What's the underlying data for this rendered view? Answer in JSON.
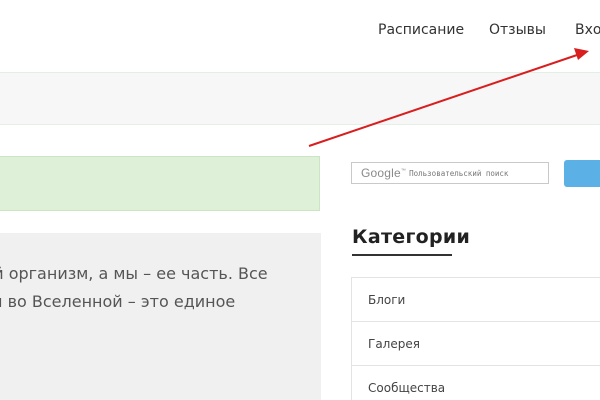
{
  "nav": {
    "items": [
      {
        "label": "Расписание"
      },
      {
        "label": "Отзывы"
      },
      {
        "label": "Вход,"
      }
    ]
  },
  "content": {
    "lines": [
      "вой организм, а мы – ее часть. Все",
      "сти во Вселенной – это единое"
    ]
  },
  "search": {
    "logo": "Google",
    "tm": "™",
    "placeholder": "Пользовательский поиск"
  },
  "categories": {
    "title": "Категории",
    "items": [
      {
        "label": "Блоги"
      },
      {
        "label": "Галерея"
      },
      {
        "label": "Сообщества"
      }
    ]
  },
  "colors": {
    "alert_bg": "#dff0d8",
    "search_button": "#5bb0e6",
    "annotation_arrow": "#d81e1e"
  }
}
